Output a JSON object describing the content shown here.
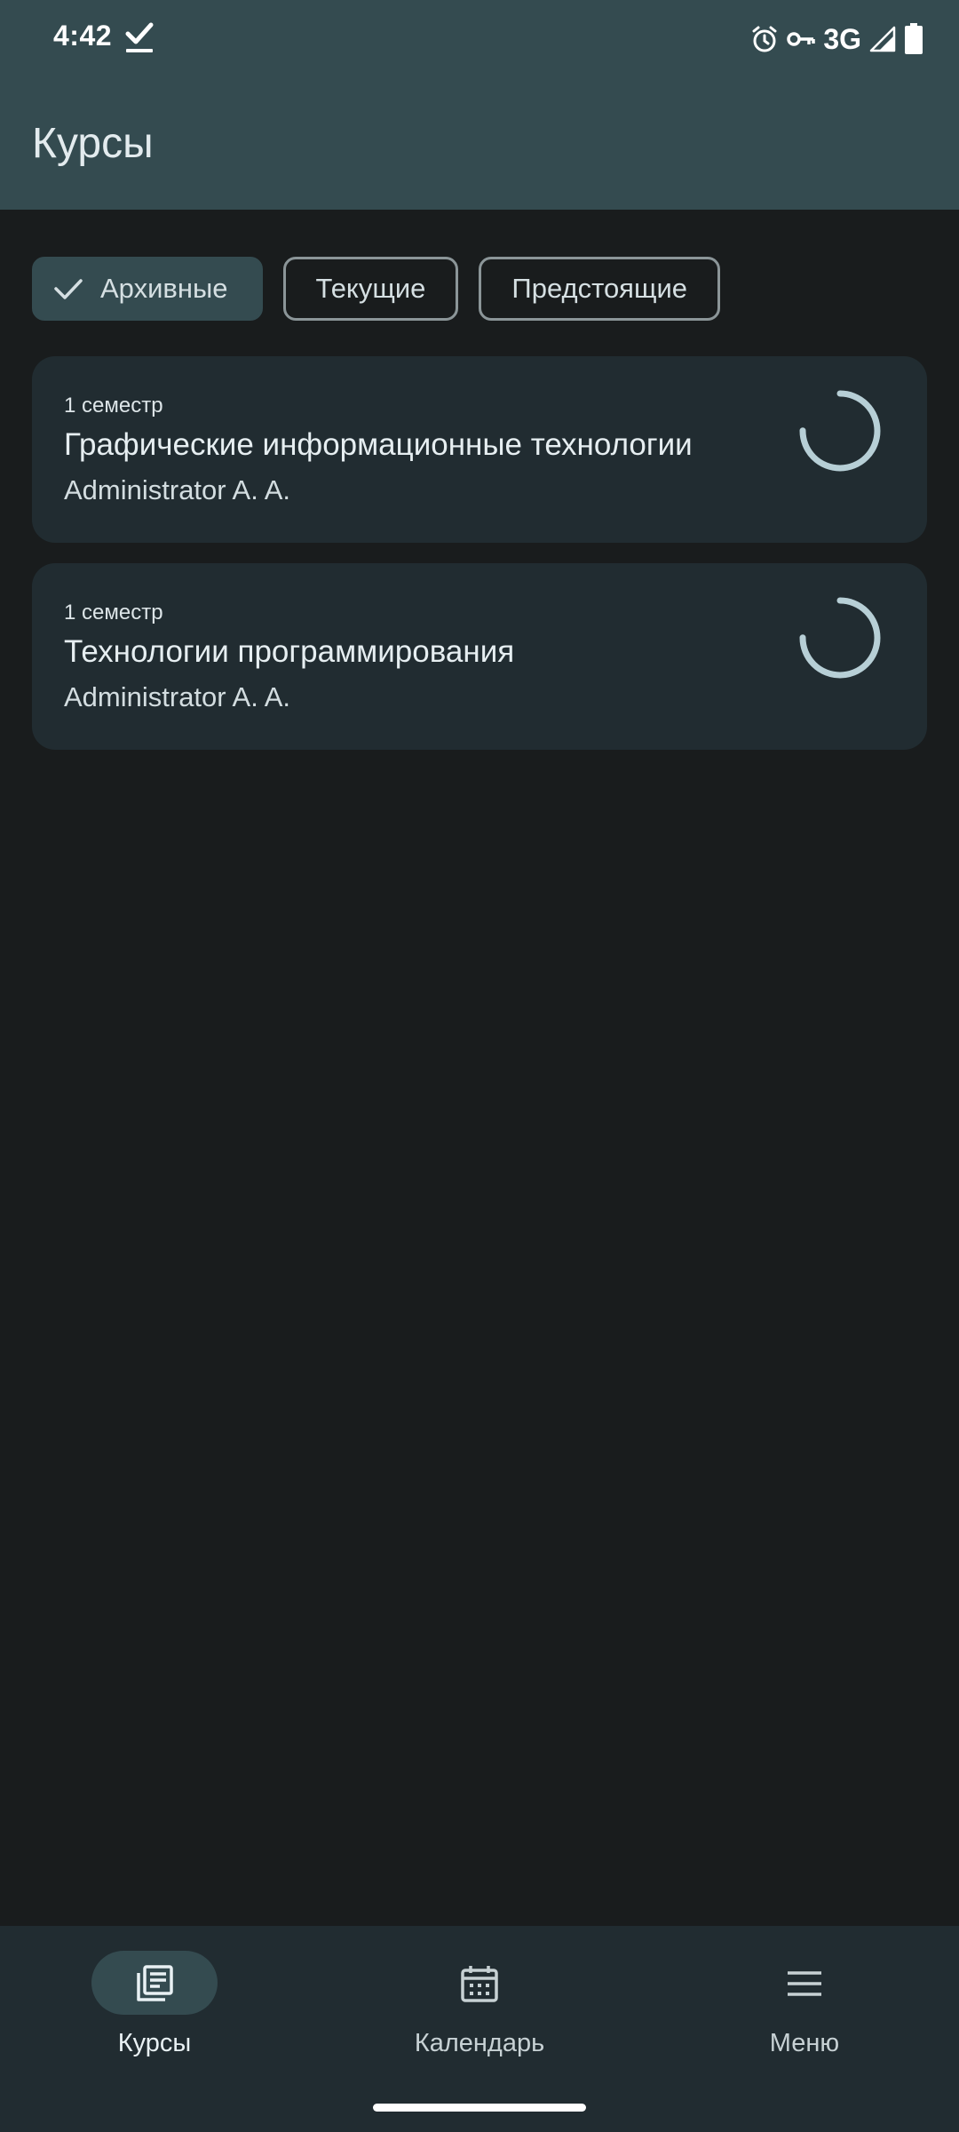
{
  "status_bar": {
    "time": "4:42",
    "network": "3G",
    "icons": [
      "check-icon",
      "alarm-icon",
      "vpn-key-icon",
      "signal-icon",
      "battery-icon"
    ]
  },
  "app_bar": {
    "title": "Курсы"
  },
  "filters": {
    "chips": [
      {
        "label": "Архивные",
        "selected": true
      },
      {
        "label": "Текущие",
        "selected": false
      },
      {
        "label": "Предстоящие",
        "selected": false
      }
    ]
  },
  "courses": [
    {
      "semester": "1 семестр",
      "title": "Графические информационные технологии",
      "teacher": "Administrator A. A.",
      "progress": 0.75
    },
    {
      "semester": "1 семестр",
      "title": "Технологии программирования",
      "teacher": "Administrator A. A.",
      "progress": 0.75
    }
  ],
  "bottom_nav": {
    "items": [
      {
        "label": "Курсы",
        "icon": "courses-icon",
        "active": true
      },
      {
        "label": "Календарь",
        "icon": "calendar-icon",
        "active": false
      },
      {
        "label": "Меню",
        "icon": "menu-icon",
        "active": false
      }
    ]
  },
  "colors": {
    "top_bar": "#344b50",
    "background": "#191c1d",
    "card": "#212c31",
    "progress_ring": "#b7cfd6"
  }
}
